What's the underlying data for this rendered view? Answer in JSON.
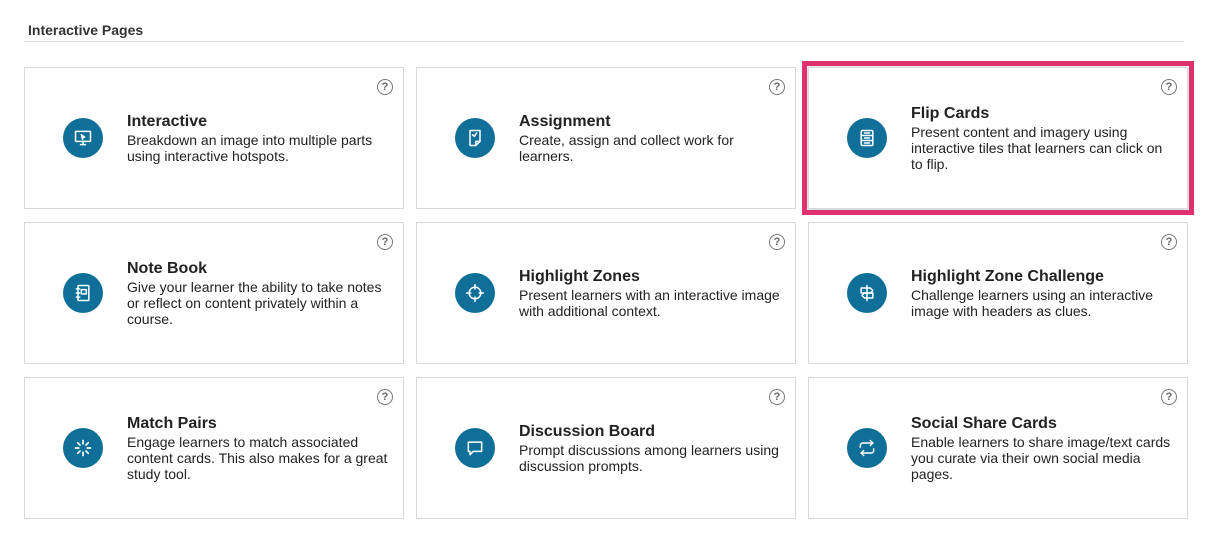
{
  "section": {
    "title": "Interactive Pages"
  },
  "cards": [
    {
      "title": "Interactive",
      "description": "Breakdown an image into multiple parts using interactive hotspots.",
      "icon": "monitor-cursor-icon",
      "help": "?"
    },
    {
      "title": "Assignment",
      "description": "Create, assign and collect work for learners.",
      "icon": "assignment-doc-icon",
      "help": "?"
    },
    {
      "title": "Flip Cards",
      "description": "Present content and imagery using interactive tiles that learners can click on to flip.",
      "icon": "flip-cards-icon",
      "help": "?",
      "selected": true
    },
    {
      "title": "Note Book",
      "description": "Give your learner the ability to take notes or reflect on content privately within a course.",
      "icon": "notebook-icon",
      "help": "?"
    },
    {
      "title": "Highlight Zones",
      "description": "Present learners with an interactive image with additional context.",
      "icon": "crosshair-icon",
      "help": "?"
    },
    {
      "title": "Highlight Zone Challenge",
      "description": "Challenge learners using an interactive image with headers as clues.",
      "icon": "signpost-icon",
      "help": "?"
    },
    {
      "title": "Match Pairs",
      "description": "Engage learners to match associated content cards. This also makes for a great study tool.",
      "icon": "loader-burst-icon",
      "help": "?"
    },
    {
      "title": "Discussion Board",
      "description": "Prompt discussions among learners using discussion prompts.",
      "icon": "chat-bubble-icon",
      "help": "?"
    },
    {
      "title": "Social Share Cards",
      "description": "Enable learners to share image/text cards you curate via their own social media pages.",
      "icon": "share-repeat-icon",
      "help": "?"
    }
  ],
  "colors": {
    "icon_bg": "#0f6f98",
    "selected_outline": "#e0316f",
    "border": "#d9d9d9"
  }
}
